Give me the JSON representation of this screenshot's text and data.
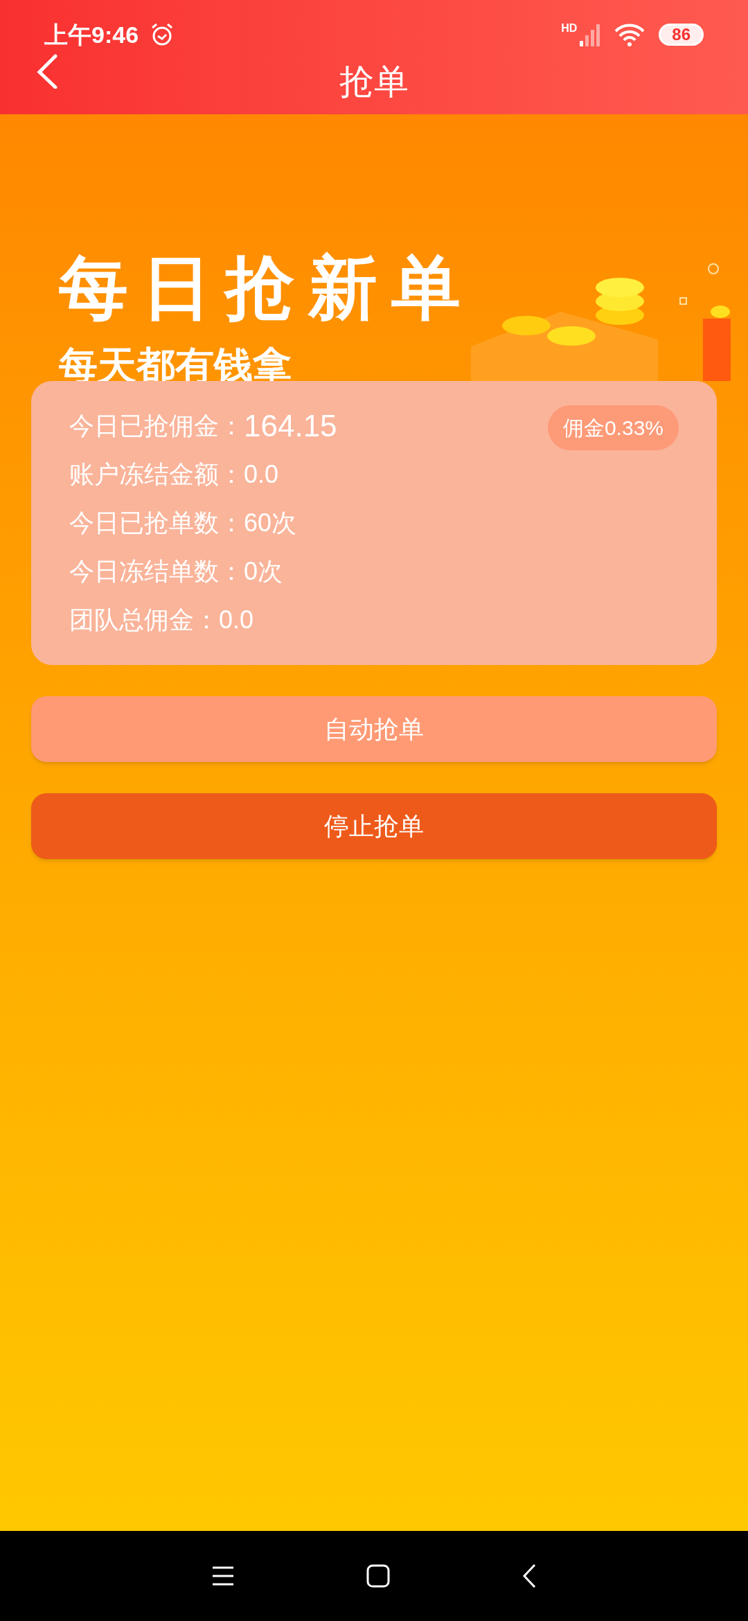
{
  "status_bar": {
    "time": "上午9:46",
    "network": "HD",
    "battery": "86"
  },
  "header": {
    "title": "抢单"
  },
  "banner": {
    "title": "每日抢新单",
    "subtitle": "每天都有钱拿"
  },
  "stats_card": {
    "badge": "佣金0.33%",
    "rows": [
      {
        "label": "今日已抢佣金：",
        "value": "164.15",
        "emphasis": true
      },
      {
        "label": "账户冻结金额：",
        "value": "0.0",
        "emphasis": false
      },
      {
        "label": "今日已抢单数：",
        "value": "60次",
        "emphasis": false
      },
      {
        "label": "今日冻结单数：",
        "value": "0次",
        "emphasis": false
      },
      {
        "label": "团队总佣金：",
        "value": "0.0",
        "emphasis": false
      }
    ]
  },
  "buttons": [
    {
      "label": "自动抢单",
      "kind": "start"
    },
    {
      "label": "停止抢单",
      "kind": "stop"
    }
  ]
}
